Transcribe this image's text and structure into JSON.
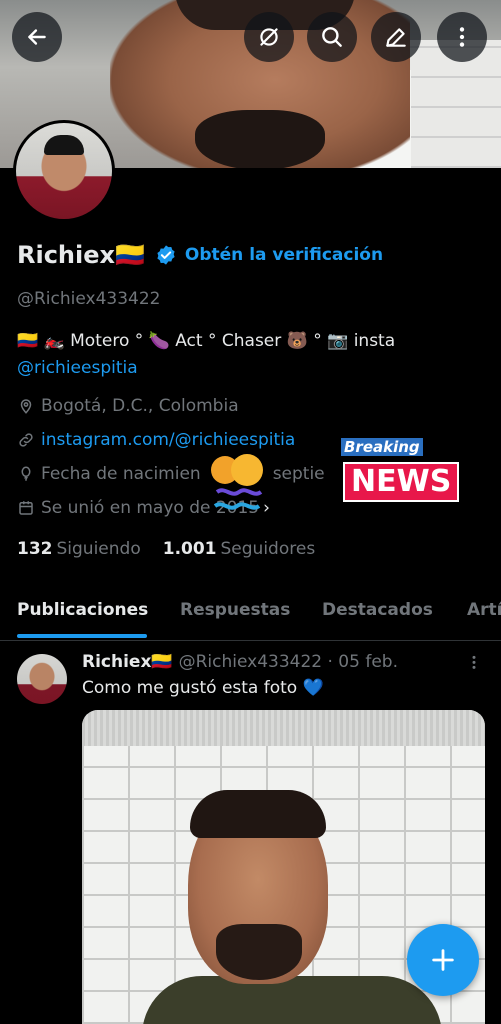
{
  "profile": {
    "name": "Richiex🇨🇴",
    "get_verified": "Obtén la verificación",
    "handle": "@Richiex433422",
    "bio_line": "🇨🇴 🏍️ Motero ° 🍆 Act ° Chaser 🐻 ° 📷 insta",
    "bio_mention": "@richieespitia",
    "location": "Bogotá, D.C., Colombia",
    "website": "instagram.com/@richieespitia",
    "birth": "Fecha de nacimien",
    "birth_tail": "septie",
    "joined": "Se unió en mayo de 2015",
    "following_count": "132",
    "following_label": "Siguiendo",
    "followers_count": "1.001",
    "followers_label": "Seguidores"
  },
  "sticker": {
    "line1": "Breaking",
    "line2": "NEWS"
  },
  "tabs": [
    {
      "label": "Publicaciones"
    },
    {
      "label": "Respuestas"
    },
    {
      "label": "Destacados"
    },
    {
      "label": "Artí"
    }
  ],
  "post": {
    "name": "Richiex🇨🇴",
    "handle": "@Richiex433422 · 05 feb.",
    "text": "Como me gustó esta foto 💙"
  },
  "icons": {
    "back": "back-arrow-icon",
    "no_sync": "no-notifications-icon",
    "search": "search-icon",
    "edit": "edit-icon",
    "more": "more-vertical-icon",
    "verified": "verified-badge-icon",
    "location": "location-pin-icon",
    "link": "link-icon",
    "birth": "balloon-icon",
    "calendar": "calendar-icon",
    "compose": "plus-icon",
    "post_more": "more-vertical-icon"
  },
  "colors": {
    "accent": "#1d9bf0",
    "background": "#000000",
    "text": "#e7e9ea",
    "secondary_text": "#71767b"
  }
}
